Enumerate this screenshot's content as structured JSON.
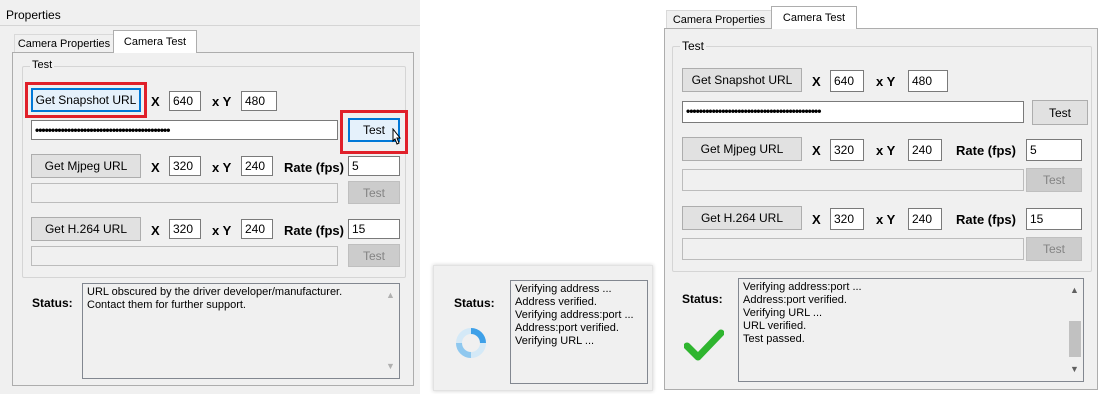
{
  "panel1": {
    "header": "Properties",
    "tabs": [
      "Camera Properties",
      "Camera Test"
    ],
    "group_title": "Test",
    "snapshot": {
      "button": "Get Snapshot URL",
      "x_label": "X",
      "x_value": "640",
      "y_label": "x Y",
      "y_value": "480",
      "password": "••••••••••••••••••••••••••••••••••••••••••",
      "test": "Test"
    },
    "mjpeg": {
      "button": "Get Mjpeg URL",
      "x_label": "X",
      "x_value": "320",
      "y_label": "x Y",
      "y_value": "240",
      "rate_label": "Rate (fps)",
      "rate_value": "5",
      "test": "Test"
    },
    "h264": {
      "button": "Get H.264 URL",
      "x_label": "X",
      "x_value": "320",
      "y_label": "x Y",
      "y_value": "240",
      "rate_label": "Rate (fps)",
      "rate_value": "15",
      "test": "Test"
    },
    "status_label": "Status:",
    "status_lines": [
      "URL obscured by the driver developer/manufacturer.",
      "Contact them for further support."
    ]
  },
  "panel2": {
    "status_label": "Status:",
    "status_lines": [
      "Verifying address ...",
      "Address verified.",
      "Verifying address:port ...",
      "Address:port verified.",
      "Verifying URL ..."
    ]
  },
  "panel3": {
    "tabs": [
      "Camera Properties",
      "Camera Test"
    ],
    "group_title": "Test",
    "snapshot": {
      "button": "Get Snapshot URL",
      "x_label": "X",
      "x_value": "640",
      "y_label": "x Y",
      "y_value": "480",
      "password": "••••••••••••••••••••••••••••••••••••••••••",
      "test": "Test"
    },
    "mjpeg": {
      "button": "Get Mjpeg URL",
      "x_label": "X",
      "x_value": "320",
      "y_label": "x Y",
      "y_value": "240",
      "rate_label": "Rate (fps)",
      "rate_value": "5",
      "test": "Test"
    },
    "h264": {
      "button": "Get H.264 URL",
      "x_label": "X",
      "x_value": "320",
      "y_label": "x Y",
      "y_value": "240",
      "rate_label": "Rate (fps)",
      "rate_value": "15",
      "test": "Test"
    },
    "status_label": "Status:",
    "status_lines": [
      "Verifying address:port ...",
      "Address:port verified.",
      "Verifying URL ...",
      "URL verified.",
      "Test passed."
    ]
  },
  "colors": {
    "highlight": "#e0202a",
    "check": "#2fb52f",
    "spinner": "#3ea0e8"
  }
}
